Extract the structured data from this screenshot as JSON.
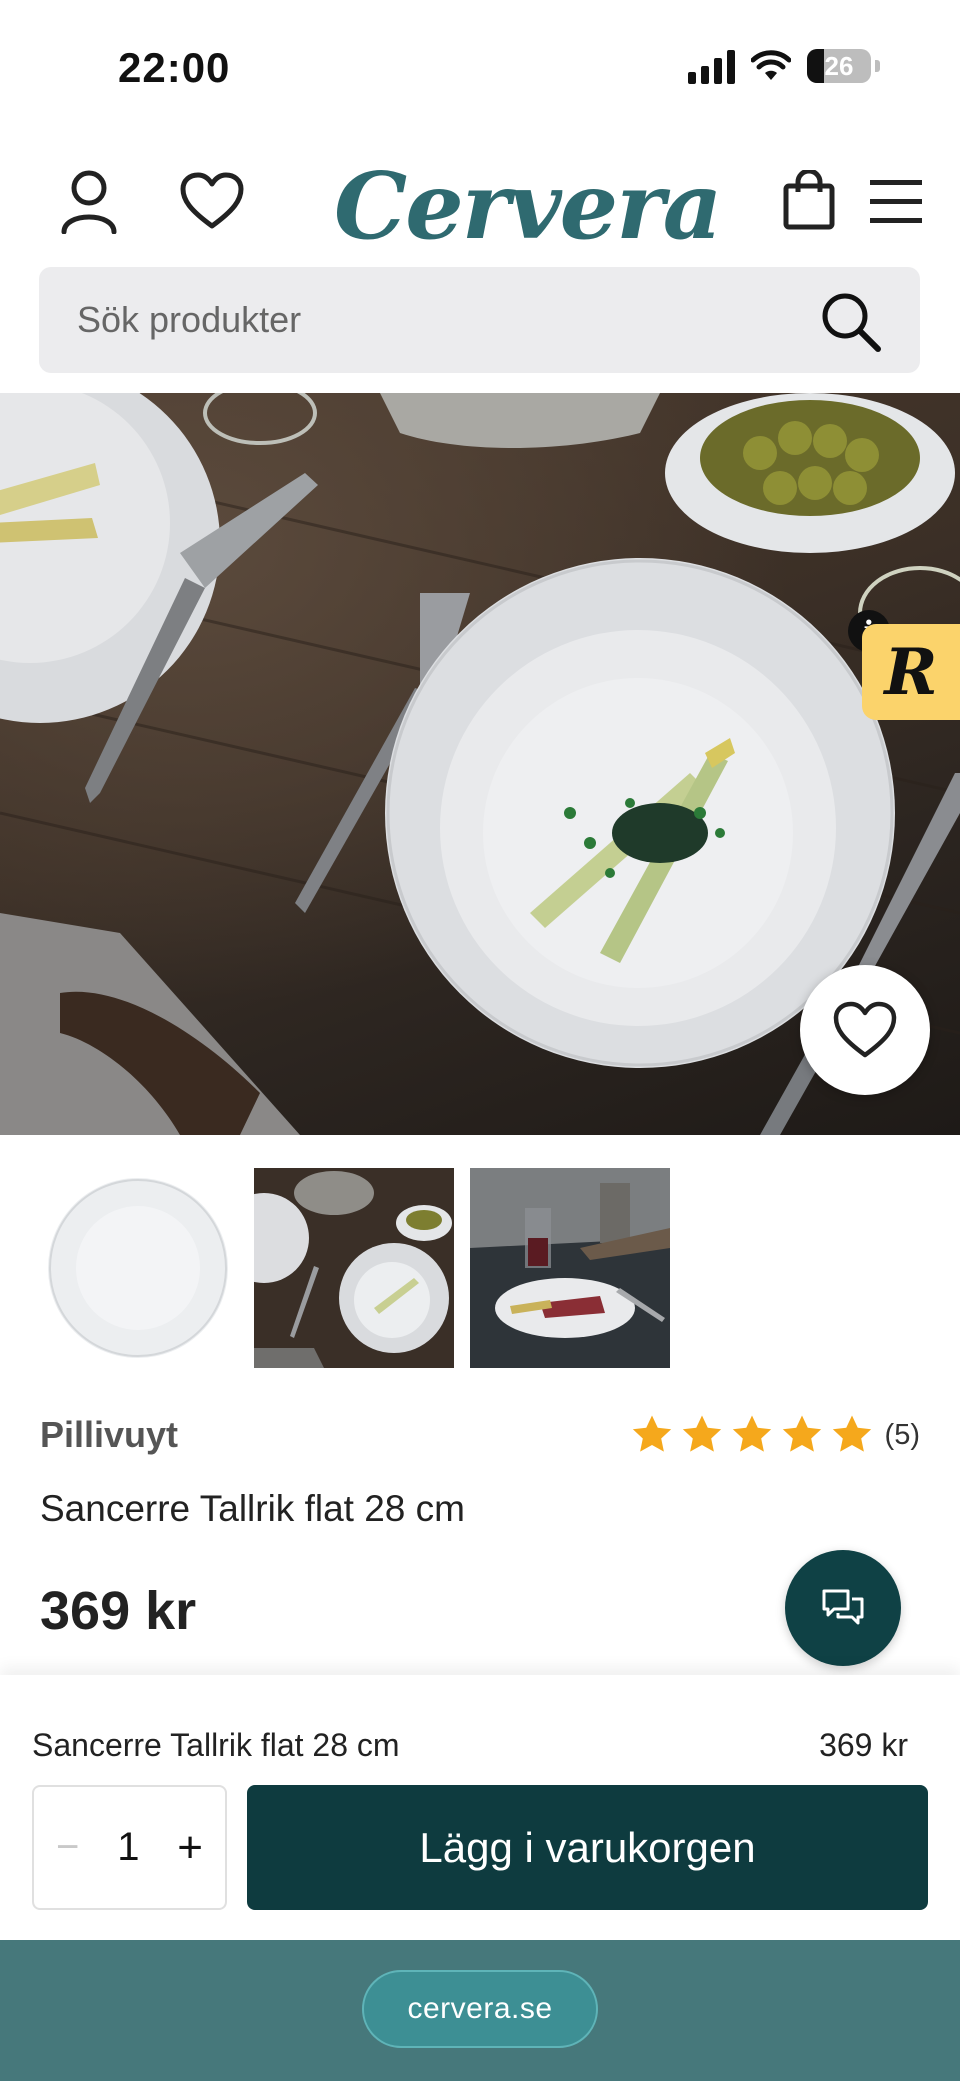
{
  "status_bar": {
    "time": "22:00",
    "battery": "26"
  },
  "header": {
    "logo": "Cervera"
  },
  "search": {
    "placeholder": "Sök produkter"
  },
  "product": {
    "brand": "Pillivuyt",
    "title": "Sancerre Tallrik flat 28 cm",
    "price": "369 kr",
    "rating": {
      "stars": 5,
      "count_label": "(5)"
    }
  },
  "sticky_bar": {
    "title": "Sancerre Tallrik flat 28 cm",
    "price": "369 kr",
    "quantity": "1",
    "minus": "−",
    "plus": "+",
    "add_label": "Lägg i varukorgen"
  },
  "badge": {
    "letter": "R",
    "info": "i"
  },
  "browser": {
    "url": "cervera.se"
  },
  "colors": {
    "brand": "#2f6a70",
    "dark_teal": "#0e3b3f",
    "star": "#f5a81c",
    "badge": "#fbd36b",
    "url_bar": "#46787b"
  }
}
